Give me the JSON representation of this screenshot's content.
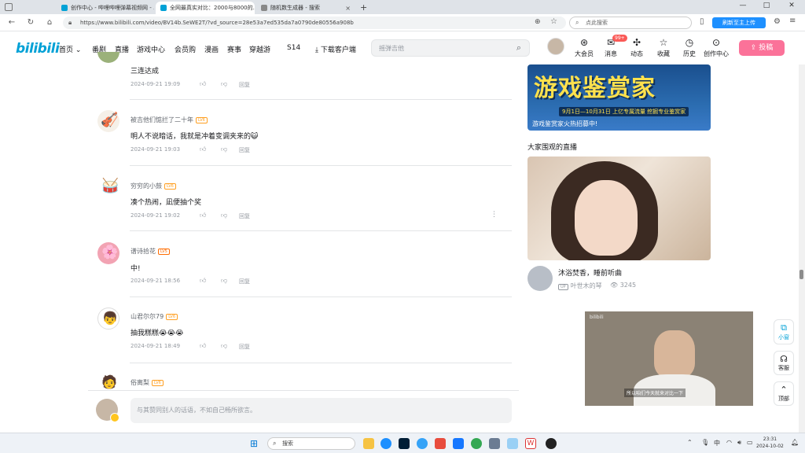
{
  "browser": {
    "tabs": [
      {
        "label": "创作中心 - 哔哩哔哩弹幕视频网 - ...",
        "active": false
      },
      {
        "label": "全网最真实对比：2000与8000的...",
        "active": true
      },
      {
        "label": "随机数生成器 - 搜索",
        "active": false
      }
    ],
    "new_tab": "+",
    "url": "https://www.bilibili.com/video/BV14b.SeWE2T/?vd_source=28e53a7ed535da7a0790de80556a908b",
    "web_search_placeholder": "点此搜索",
    "ext_button": "刷新至主上传"
  },
  "header": {
    "logo": "bilibili",
    "nav": [
      "首页",
      "番剧",
      "直播",
      "游戏中心",
      "会员购",
      "漫画",
      "赛事",
      "穿越游",
      "S14",
      "下载客户端"
    ],
    "search_placeholder": "摇弹吉他",
    "icons": [
      {
        "name": "big-member-icon",
        "glyph": "⊛",
        "label": "大会员"
      },
      {
        "name": "message-icon",
        "glyph": "✉",
        "label": "消息",
        "badge": "99+"
      },
      {
        "name": "dynamic-icon",
        "glyph": "✣",
        "label": "动态"
      },
      {
        "name": "favorite-icon",
        "glyph": "☆",
        "label": "收藏"
      },
      {
        "name": "history-icon",
        "glyph": "◷",
        "label": "历史"
      },
      {
        "name": "creator-icon",
        "glyph": "⊙",
        "label": "创作中心"
      }
    ],
    "upload_label": "投稿"
  },
  "comments": [
    {
      "user": "",
      "text": "三连达成",
      "time": "2024-09-21 19:09",
      "reply": "回复"
    },
    {
      "user": "被吉他们惦拦了二十年",
      "text": "明人不说暗话，我就是冲着变调夹来的😺",
      "time": "2024-09-21 19:03",
      "reply": "回复"
    },
    {
      "user": "穷穷的小鼓",
      "text": "凑个热闹，凪便抽个奖",
      "time": "2024-09-21 19:02",
      "reply": "回复"
    },
    {
      "user": "谱诗拾花",
      "text": "中!",
      "time": "2024-09-21 18:56",
      "reply": "回复"
    },
    {
      "user": "山君尔尔79",
      "text": "抽我糕糕😭😭😭",
      "time": "2024-09-21 18:49",
      "reply": "回复"
    },
    {
      "user": "俗离梨",
      "text": "",
      "time": "",
      "reply": ""
    }
  ],
  "reply_box": {
    "placeholder": "与其赞同别人的话语，不如自己畅所欲言。"
  },
  "sidebar": {
    "ad_title": "游戏鉴赏家",
    "ad_sub": "9月1日—10月31日  上亿专属流量  挖掘专业鉴赏家",
    "ad_caption": "游戏鉴赏家火热招募中!",
    "section_title": "大家围观的直播",
    "live": {
      "title": "沐浴焚香，睡前听曲",
      "up_tag": "UP",
      "host": "叶世木的琴",
      "viewers": "3245"
    },
    "mini_player_sub": "所以咱们今天就来对比一下",
    "float_buttons": [
      {
        "name": "mini-window-icon",
        "glyph": "⧉",
        "label": "小窗"
      },
      {
        "name": "customer-service-icon",
        "glyph": "☊",
        "label": "客服"
      },
      {
        "name": "back-to-top-icon",
        "glyph": "⌃",
        "label": "顶部"
      }
    ]
  },
  "taskbar": {
    "search": "搜索",
    "time": "23:31",
    "date": "2024-10-02",
    "lang": "中"
  },
  "colors": {
    "brand": "#00a1d6",
    "pink": "#fb7299",
    "level": "#ff9f21"
  }
}
